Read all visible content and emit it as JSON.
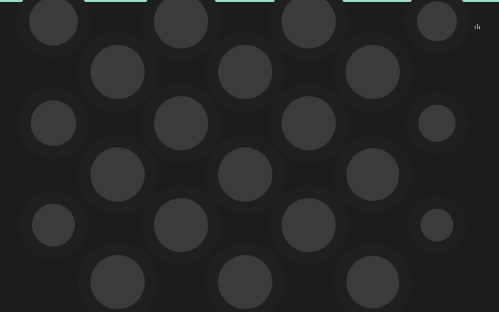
{
  "canvas": {
    "background_color": "#1c1c1c",
    "accent_color": "#9fd6c9",
    "dot_color": "#3b3b3b",
    "halo_color": "#1f1f1f"
  },
  "overlay": {
    "icon": "bars-icon"
  }
}
